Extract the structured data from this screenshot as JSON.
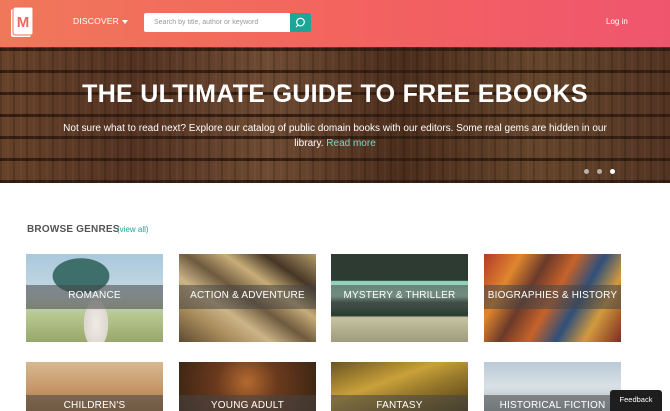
{
  "header": {
    "logo_letter": "M",
    "discover_label": "DISCOVER",
    "search_placeholder": "Search by title, author or keyword",
    "login_label": "Log in",
    "colors": {
      "gradient_start": "#f0785a",
      "gradient_end": "#f0556e",
      "accent": "#1fa598"
    }
  },
  "hero": {
    "title": "THE ULTIMATE GUIDE TO FREE EBOOKS",
    "subtitle": "Not sure what to read next? Explore our catalog of public domain books with our editors. Some real gems are hidden in our library.",
    "read_more": "Read more",
    "slides_total": 3,
    "active_slide": 3
  },
  "genres": {
    "heading": "BROWSE GENRES",
    "view_all": "(view all)",
    "items": [
      {
        "label": "ROMANCE"
      },
      {
        "label": "ACTION & ADVENTURE"
      },
      {
        "label": "MYSTERY & THRILLER"
      },
      {
        "label": "BIOGRAPHIES & HISTORY"
      },
      {
        "label": "CHILDREN'S"
      },
      {
        "label": "YOUNG ADULT"
      },
      {
        "label": "FANTASY"
      },
      {
        "label": "HISTORICAL FICTION"
      }
    ]
  },
  "feedback_label": "Feedback"
}
